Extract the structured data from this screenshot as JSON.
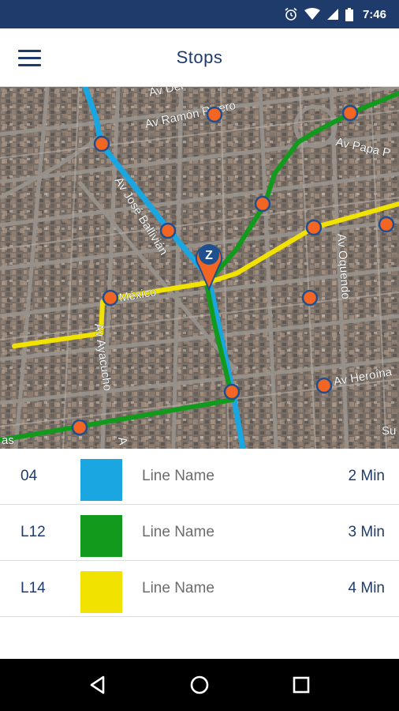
{
  "status_bar": {
    "time": "7:46",
    "icons": [
      "alarm-icon",
      "wifi-icon",
      "signal-icon",
      "battery-icon"
    ]
  },
  "app_bar": {
    "title": "Stops",
    "menu_icon": "hamburger-menu-icon"
  },
  "map": {
    "street_labels": [
      "Av Der",
      "Av Ramón Rivero",
      "Av Papa P",
      "Av José Ballivián",
      "México",
      "Av Oquendo",
      "Av Ayacucho",
      "Av Heroína",
      "Su",
      "as",
      "A"
    ],
    "stop_marker_letter": "Z",
    "route_colors": {
      "line_04": "#1aa6e0",
      "line_L12": "#129a1c",
      "line_L14": "#f2e200"
    },
    "stop_color": "#f26522"
  },
  "lines": [
    {
      "code": "04",
      "name": "Line Name",
      "eta": "2 Min",
      "color": "#1aa6e0"
    },
    {
      "code": "L12",
      "name": "Line Name",
      "eta": "3 Min",
      "color": "#129a1c"
    },
    {
      "code": "L14",
      "name": "Line Name",
      "eta": "4 Min",
      "color": "#f2e200"
    }
  ],
  "nav_bar": {
    "icons": [
      "back-icon",
      "home-icon",
      "recents-icon"
    ]
  }
}
